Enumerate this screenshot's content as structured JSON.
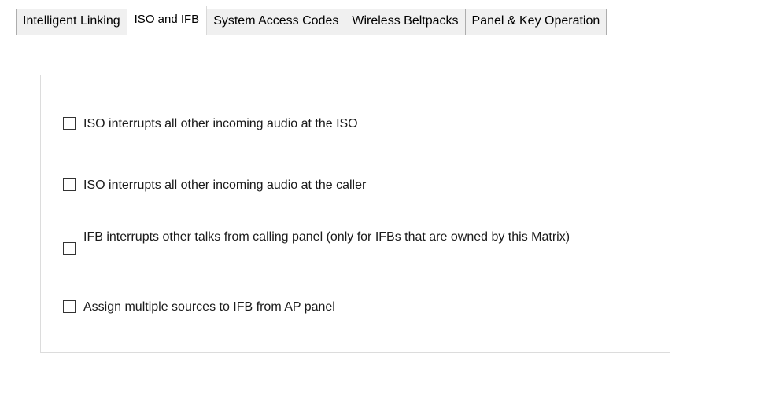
{
  "tabs": [
    {
      "label": "Intelligent Linking",
      "selected": false
    },
    {
      "label": "ISO and IFB",
      "selected": true
    },
    {
      "label": "System Access Codes",
      "selected": false
    },
    {
      "label": "Wireless Beltpacks",
      "selected": false
    },
    {
      "label": "Panel & Key Operation",
      "selected": false
    }
  ],
  "options": [
    {
      "label": "ISO interrupts all other incoming audio at the ISO",
      "checked": false
    },
    {
      "label": "ISO interrupts all other incoming audio at the caller",
      "checked": false
    },
    {
      "label": "IFB interrupts other talks from calling panel (only for IFBs that are owned by this Matrix)",
      "checked": false
    },
    {
      "label": "Assign multiple sources to IFB from AP panel",
      "checked": false
    }
  ]
}
